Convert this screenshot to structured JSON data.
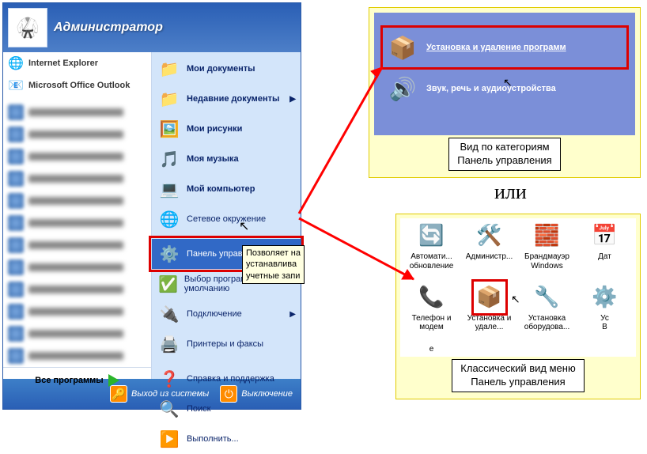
{
  "startmenu": {
    "user": "Администратор",
    "left": {
      "ie": "Internet Explorer",
      "outlook": "Microsoft Office Outlook",
      "all_programs": "Все программы"
    },
    "right": {
      "mydocs": "Мои документы",
      "recent": "Недавние документы",
      "mypics": "Мои рисунки",
      "mymusic": "Моя музыка",
      "mycomp": "Мой компьютер",
      "network": "Сетевое окружение",
      "cpanel": "Панель управления",
      "defaults": "Выбор программ по умолчанию",
      "connect": "Подключение",
      "printers": "Принтеры и факсы",
      "help": "Справка и поддержка",
      "search": "Поиск",
      "run": "Выполнить..."
    },
    "tooltip": "Позволяет на\nустанавлива\nучетные запи",
    "footer": {
      "logoff": "Выход из системы",
      "shutdown": "Выключение"
    }
  },
  "panel_top": {
    "addremove": "Установка и удаление программ",
    "sound": "Звук, речь и аудиоустройства",
    "caption1": "Вид по категориям",
    "caption2": "Панель управления"
  },
  "or": "или",
  "panel_bottom": {
    "items": [
      "Автомати...\nобновление",
      "Администр...",
      "Брандмауэр\nWindows",
      "Дат",
      "Телефон и\nмодем",
      "Установка и\nудале...",
      "Установка\nоборудова...",
      "Ус\nВ"
    ],
    "ellipsis": "е",
    "caption1": "Классический вид меню",
    "caption2": "Панель управления"
  }
}
